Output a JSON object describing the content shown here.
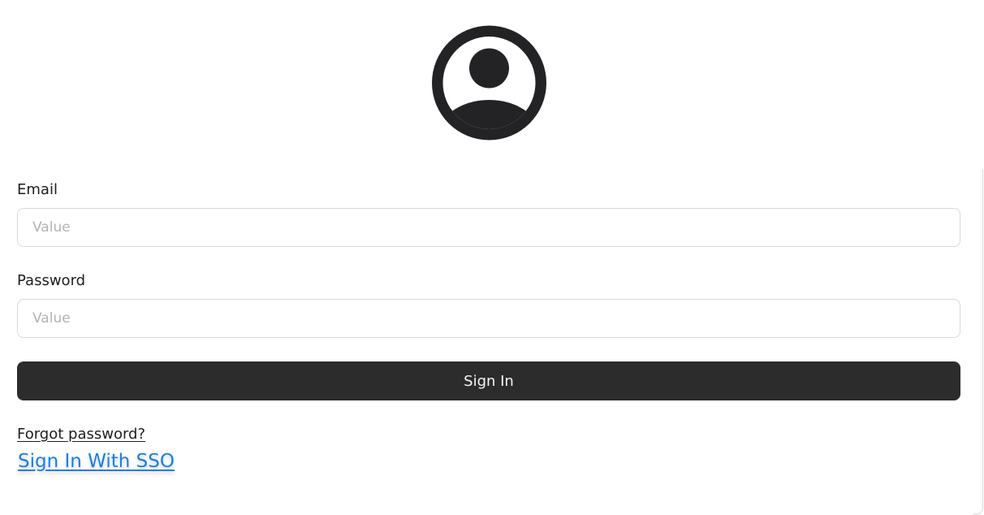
{
  "avatar": {
    "icon": "user-avatar-icon",
    "color": "#232225"
  },
  "form": {
    "email_label": "Email",
    "email_placeholder": "Value",
    "password_label": "Password",
    "password_placeholder": "Value",
    "signin_label": "Sign In",
    "forgot_label": "Forgot password?",
    "sso_label": "Sign In With SSO"
  },
  "colors": {
    "button_bg": "#2c2c2c",
    "sso_link": "#1a7ee6",
    "border": "#d9d9d9"
  }
}
